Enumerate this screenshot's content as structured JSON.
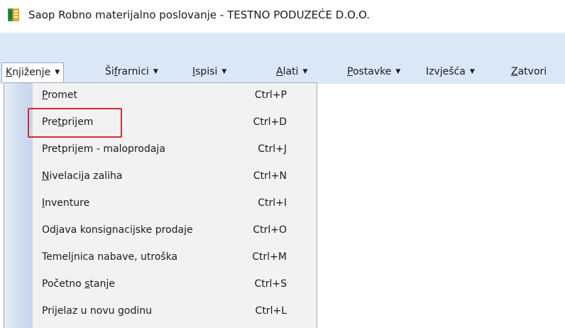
{
  "window": {
    "title": "Saop  Robno materijalno poslovanje - TESTNO PODUZEĆE D.O.O.",
    "icon": "saop-app-icon"
  },
  "menubar": {
    "knjizenje_pre": "",
    "knjizenje_u": "K",
    "knjizenje_post": "njiženje",
    "sifrarnici_pre": "Ši",
    "sifrarnici_u": "f",
    "sifrarnici_post": "rarnici",
    "ispisi_pre": "",
    "ispisi_u": "I",
    "ispisi_post": "spisi",
    "alati_pre": "",
    "alati_u": "A",
    "alati_post": "lati",
    "postavke_pre": "",
    "postavke_u": "P",
    "postavke_post": "ostavke",
    "izvjesca": "Izvješća",
    "zatvori_pre": "",
    "zatvori_u": "Z",
    "zatvori_post": "atvori",
    "arrow": "▼"
  },
  "dropdown": {
    "items": [
      {
        "pre": "",
        "u": "P",
        "post": "romet",
        "shortcut": "Ctrl+P"
      },
      {
        "pre": "Pre",
        "u": "t",
        "post": "prijem",
        "shortcut": "Ctrl+D"
      },
      {
        "pre": "Pretprijem - maloproda",
        "u": "j",
        "post": "a",
        "shortcut": "Ctrl+J"
      },
      {
        "pre": "",
        "u": "N",
        "post": "ivelacija zaliha",
        "shortcut": "Ctrl+N"
      },
      {
        "pre": "",
        "u": "I",
        "post": "nventure",
        "shortcut": "Ctrl+I"
      },
      {
        "pre": "Odjava konsignacijske prodaje",
        "u": "",
        "post": "",
        "shortcut": "Ctrl+O"
      },
      {
        "pre": "Temeljnica nabave, utroška",
        "u": "",
        "post": "",
        "shortcut": "Ctrl+M"
      },
      {
        "pre": "Početno ",
        "u": "s",
        "post": "tanje",
        "shortcut": "Ctrl+S"
      },
      {
        "pre": "Prijelaz u novu ",
        "u": "g",
        "post": "odinu",
        "shortcut": "Ctrl+L"
      }
    ]
  },
  "colors": {
    "menubar_bg": "#dae7f6",
    "highlight": "#d92b2b"
  }
}
